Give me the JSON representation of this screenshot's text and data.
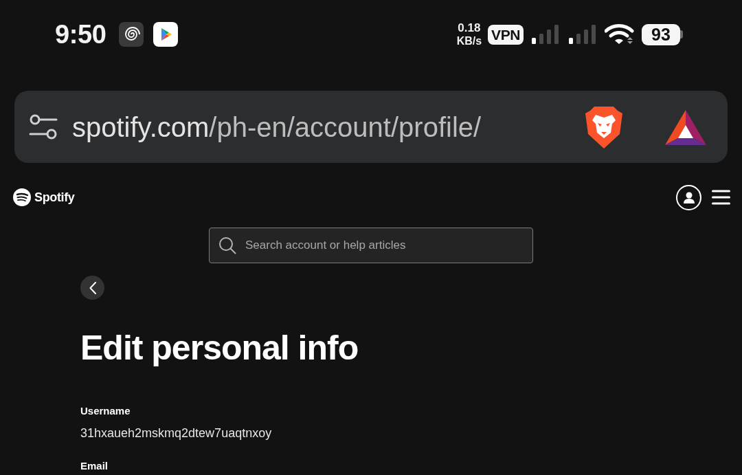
{
  "status_bar": {
    "time": "9:50",
    "net_speed": "0.18",
    "net_speed_unit": "KB/s",
    "vpn": "VPN",
    "battery": "93"
  },
  "address_bar": {
    "domain": "spotify.com",
    "path": "/ph-en/account/profile/"
  },
  "site_header": {
    "logo_text": "Spotify"
  },
  "search": {
    "placeholder": "Search account or help articles"
  },
  "page": {
    "title": "Edit personal info",
    "fields": [
      {
        "label": "Username",
        "value": "31hxaueh2mskmq2dtew7uaqtnxoy"
      },
      {
        "label": "Email"
      }
    ]
  }
}
